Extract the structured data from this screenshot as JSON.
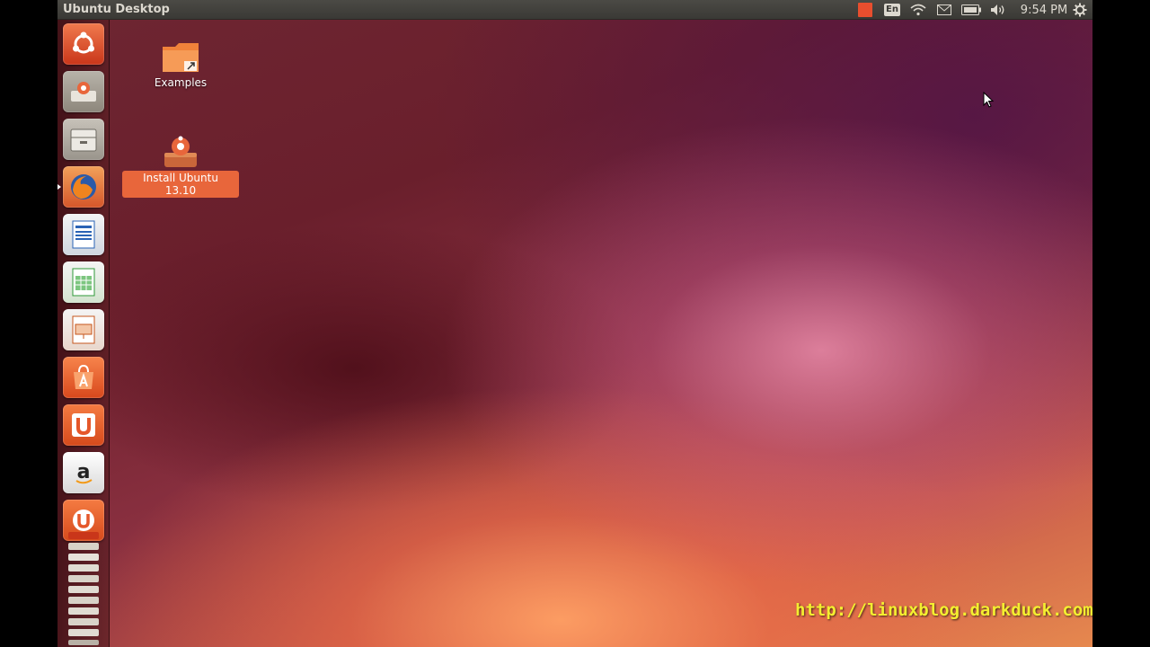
{
  "topbar": {
    "title": "Ubuntu Desktop",
    "keyboard_layout": "En",
    "clock": "9:54 PM",
    "icons": [
      "notification-square-icon",
      "keyboard-layout-icon",
      "wifi-icon",
      "mail-icon",
      "battery-icon",
      "volume-icon",
      "gear-icon"
    ]
  },
  "launcher": {
    "items": [
      {
        "name": "dash-home",
        "icon": "ubuntu-logo-icon"
      },
      {
        "name": "install-ubuntu",
        "icon": "installer-icon"
      },
      {
        "name": "files",
        "icon": "file-cabinet-icon"
      },
      {
        "name": "firefox",
        "icon": "firefox-icon"
      },
      {
        "name": "libreoffice-writer",
        "icon": "writer-icon"
      },
      {
        "name": "libreoffice-calc",
        "icon": "calc-icon"
      },
      {
        "name": "libreoffice-impress",
        "icon": "impress-icon"
      },
      {
        "name": "ubuntu-software-center",
        "icon": "software-center-icon"
      },
      {
        "name": "ubuntu-one",
        "icon": "ubuntu-one-icon"
      },
      {
        "name": "amazon",
        "icon": "amazon-icon"
      },
      {
        "name": "ubuntu-one-music",
        "icon": "ubuntu-one-music-icon"
      },
      {
        "name": "workspace-stack",
        "icon": "stacked-tiles-icon"
      }
    ]
  },
  "desktop": {
    "icons": [
      {
        "label": "Examples",
        "icon": "folder-link-icon",
        "selected": false
      },
      {
        "label": "Install Ubuntu 13.10",
        "icon": "installer-icon",
        "selected": true
      }
    ]
  },
  "watermark": "http://linuxblog.darkduck.com",
  "colors": {
    "accent": "#e8663b",
    "panel": "#3c3b37",
    "watermark": "#f4ee30"
  }
}
